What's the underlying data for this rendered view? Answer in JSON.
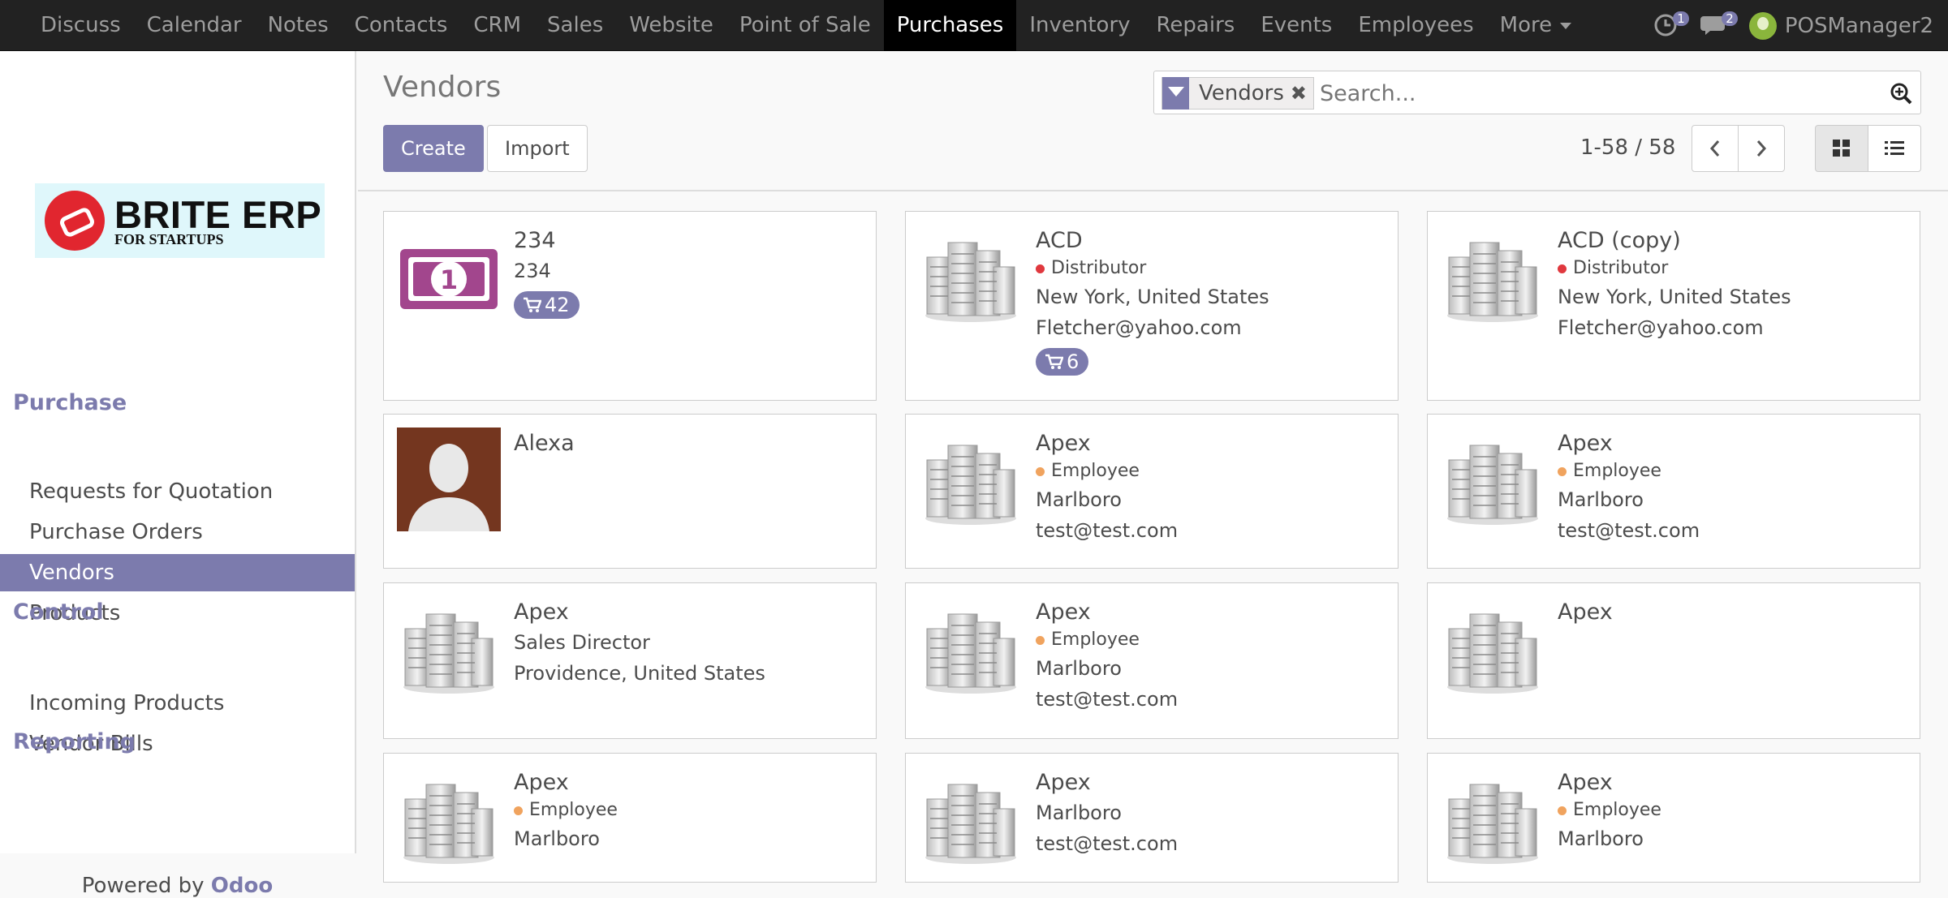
{
  "topbar": {
    "menu": [
      "Discuss",
      "Calendar",
      "Notes",
      "Contacts",
      "CRM",
      "Sales",
      "Website",
      "Point of Sale",
      "Purchases",
      "Inventory",
      "Repairs",
      "Events",
      "Employees",
      "More"
    ],
    "active": "Purchases",
    "activity_count": "1",
    "messages_count": "2",
    "user": "POSManager2"
  },
  "logo": {
    "line1": "BRITE ERP",
    "line2": "FOR STARTUPS"
  },
  "sidebar": {
    "purchase_header": "Purchase",
    "purchase_items": [
      "Requests for Quotation",
      "Purchase Orders",
      "Vendors",
      "Products"
    ],
    "active_item": "Vendors",
    "control_header": "Control",
    "control_items": [
      "Incoming Products",
      "Vendor Bills"
    ],
    "reporting_header": "Reporting",
    "powered_by": "Powered by",
    "powered_brand": "Odoo"
  },
  "control_panel": {
    "title": "Vendors",
    "create_label": "Create",
    "import_label": "Import",
    "facet_label": "Vendors",
    "search_placeholder": "Search...",
    "pager": "1-58 / 58"
  },
  "colors": {
    "brand": "#7c7bad",
    "distributor_dot": "#e0383e",
    "employee_dot": "#f0a35e"
  },
  "cards": [
    {
      "name": "234",
      "image": "money-icon",
      "lines": [
        "234"
      ],
      "tag": null,
      "badge": "42"
    },
    {
      "name": "ACD",
      "image": "building-icon",
      "tag": {
        "label": "Distributor",
        "color": "#e0383e"
      },
      "lines": [
        "New York, United States",
        "Fletcher@yahoo.com"
      ],
      "badge": "6"
    },
    {
      "name": "ACD (copy)",
      "image": "building-icon",
      "tag": {
        "label": "Distributor",
        "color": "#e0383e"
      },
      "lines": [
        "New York, United States",
        "Fletcher@yahoo.com"
      ],
      "badge": null
    },
    {
      "name": "Alexa",
      "image": "person-avatar",
      "tag": null,
      "lines": [],
      "badge": null
    },
    {
      "name": "Apex",
      "image": "building-icon",
      "tag": {
        "label": "Employee",
        "color": "#f0a35e"
      },
      "lines": [
        "Marlboro",
        "test@test.com"
      ],
      "badge": null
    },
    {
      "name": "Apex",
      "image": "building-icon",
      "tag": {
        "label": "Employee",
        "color": "#f0a35e"
      },
      "lines": [
        "Marlboro",
        "test@test.com"
      ],
      "badge": null
    },
    {
      "name": "Apex",
      "image": "building-icon",
      "tag": null,
      "lines": [
        "Sales Director",
        "Providence, United States"
      ],
      "badge": null
    },
    {
      "name": "Apex",
      "image": "building-icon",
      "tag": {
        "label": "Employee",
        "color": "#f0a35e"
      },
      "lines": [
        "Marlboro",
        "test@test.com"
      ],
      "badge": null
    },
    {
      "name": "Apex",
      "image": "building-icon",
      "tag": null,
      "lines": [],
      "badge": null
    },
    {
      "name": "Apex",
      "image": "building-icon",
      "tag": {
        "label": "Employee",
        "color": "#f0a35e"
      },
      "lines": [
        "Marlboro"
      ],
      "badge": null
    },
    {
      "name": "Apex",
      "image": "building-icon",
      "tag": null,
      "lines": [
        "Marlboro",
        "test@test.com"
      ],
      "badge": null
    },
    {
      "name": "Apex",
      "image": "building-icon",
      "tag": {
        "label": "Employee",
        "color": "#f0a35e"
      },
      "lines": [
        "Marlboro"
      ],
      "badge": null
    }
  ]
}
